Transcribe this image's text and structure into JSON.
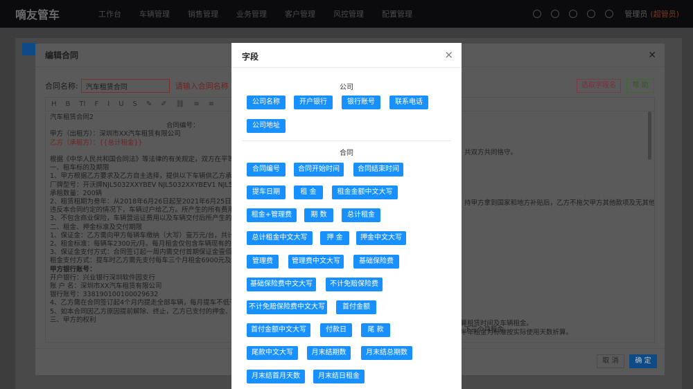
{
  "nav": {
    "brand": "嘀友管车",
    "menu": [
      "工作台",
      "车辆管理",
      "销售管理",
      "业务管理",
      "客户管理",
      "风控管理",
      "配置管理"
    ],
    "user": "管理员",
    "role": "(超管员)"
  },
  "edit_dialog": {
    "title": "编辑合同",
    "name_label": "合同名称:",
    "name_value": "汽车租赁合同",
    "name_error": "请输入合同名称",
    "pick_label": "选取字段名",
    "help_label": "帮 助",
    "cancel_label": "取 消",
    "ok_label": "确 定",
    "toolbar": [
      "H",
      "B",
      "TI",
      "F",
      "I",
      "U",
      "S",
      "✎",
      "✐",
      "⛓",
      "≡",
      "≡"
    ],
    "body_lines": [
      "汽车租赁合同2",
      "合同编号：",
      "甲方（出租方）：深圳市XX汽车租赁有限公司",
      "乙方（承租方）：{{总计租金}}",
      "",
      "根据《中华人民共和国合同法》等法律的有关规定，双方在平等自",
      "一、租车标的及期限",
      "1、甲方根据乙方要求及乙方自主选择，提供以下车辆供乙方承租",
      "厂牌型号：开沃牌NJL5032XXYBEV  NJL5032XXYBEV1  NJL50",
      "承租数量：200辆",
      "2、租赁租期为叁年：从2018年6月26日起至2021年6月25日共36",
      "违反本合同约定的情况下，车辆过户给乙方。所产生的所有费用由",
      "3、不包含商业保险，车辆营运证费用以及车辆交付后所产生的其他",
      "二、租金、押金标准及交付期限",
      "1、保证金：乙方需向甲方每辆车缴纳（大写）壹万元/台，共计贰",
      "2、租金标准：每辆车2300元/月。每月租金仅包含车辆现有的交强",
      "3、保证金支付方式：合同签订起一周内需交付首期保证金壹佰万元",
      "租金支付方式：提车时乙方需先支付每车三个月租金6900元及《",
      "甲方银行账号：",
      "开户银行：兴业银行深圳软件园支行",
      "账 户 名：深圳市XX汽车租赁有限公司",
      "银行账号：338190100100029632",
      "4、乙方需在合同签订起4个月内提走全部车辆，每月提车不低于50",
      "5、如本合同因乙方原因提前解除、终止，乙方已支付的押金、租金",
      "三、甲方的权利"
    ],
    "body_right": [
      "共双方共同恪守。",
      "持甲方拿到国家和地方补贴后，乙方不拖欠甲方其他款项及无其他",
      "下三个月租金。",
      "计算租赁时间及车辆租金。",
      "以半年租金为标准按实际使用天数折算。"
    ]
  },
  "field_modal": {
    "title": "字段",
    "close_label": "×",
    "sections": [
      {
        "title": "公司",
        "fields": [
          "公司名称",
          "开户银行",
          "银行账号",
          "联系电话",
          "公司地址"
        ]
      },
      {
        "title": "合同",
        "fields": [
          "合同编号",
          "合同开始时间",
          "合同结束时间",
          "提车日期",
          "租 金",
          "租金金额中文大写",
          "租金+管理费",
          "期 数",
          "总计租金",
          "总计租金中文大写",
          "押 金",
          "押金中文大写",
          "管理费",
          "管理费中文大写",
          "基础保险费",
          "基础保险费中文大写",
          "不计免赔保险费",
          "不计免赔保险费中文大写",
          "首付金额",
          "首付金额中文大写",
          "付款日",
          "尾 款",
          "尾款中文大写",
          "月末结期数",
          "月末结总期数",
          "月末结首月天数",
          "月末结日租金"
        ]
      }
    ]
  },
  "colors": {
    "accent": "#1890ff",
    "nav_bg": "#0b0b0d"
  }
}
